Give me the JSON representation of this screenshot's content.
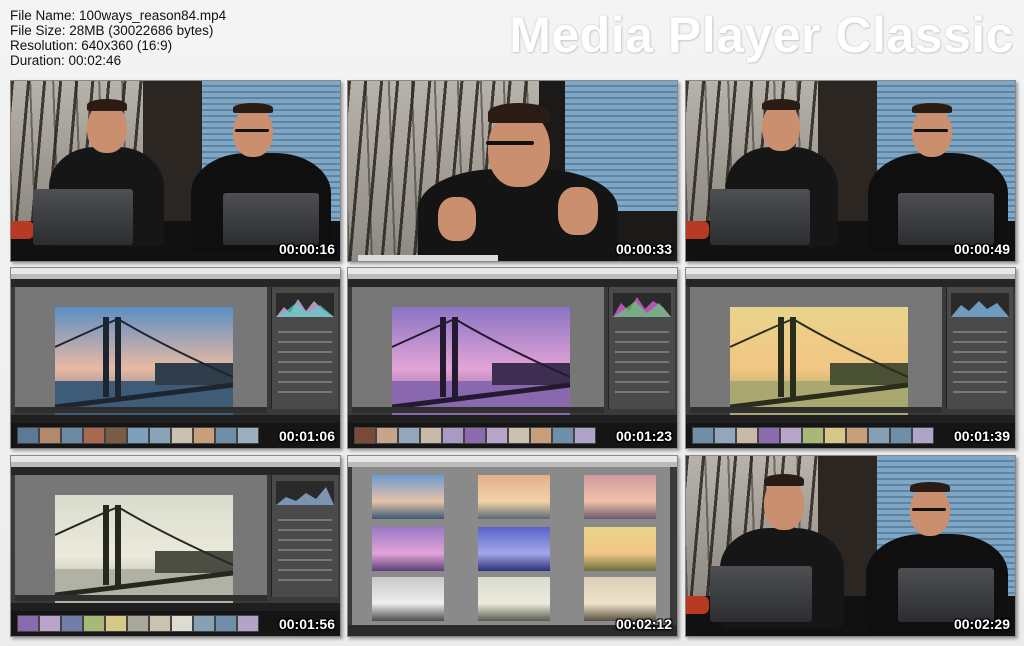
{
  "header": {
    "file_name": "File Name: 100ways_reason84.mp4",
    "file_size": "File Size: 28MB (30022686 bytes)",
    "resolution": "Resolution: 640x360 (16:9)",
    "duration": "Duration: 00:02:46",
    "brand": "Media Player Classic"
  },
  "thumbnails": [
    {
      "timestamp": "00:00:16",
      "scene": "studio-two"
    },
    {
      "timestamp": "00:00:33",
      "scene": "studio-closeup"
    },
    {
      "timestamp": "00:00:49",
      "scene": "studio-two"
    },
    {
      "timestamp": "00:01:06",
      "scene": "lightroom-develop",
      "tint": "blue"
    },
    {
      "timestamp": "00:01:23",
      "scene": "lightroom-develop",
      "tint": "purple"
    },
    {
      "timestamp": "00:01:39",
      "scene": "lightroom-develop",
      "tint": "yellow"
    },
    {
      "timestamp": "00:01:56",
      "scene": "lightroom-develop",
      "tint": "gray"
    },
    {
      "timestamp": "00:02:12",
      "scene": "lightroom-survey"
    },
    {
      "timestamp": "00:02:29",
      "scene": "studio-two"
    }
  ],
  "colors": {
    "brand_text": "#ffffff",
    "timestamp_text": "#ffffff",
    "background": "#ececec"
  }
}
